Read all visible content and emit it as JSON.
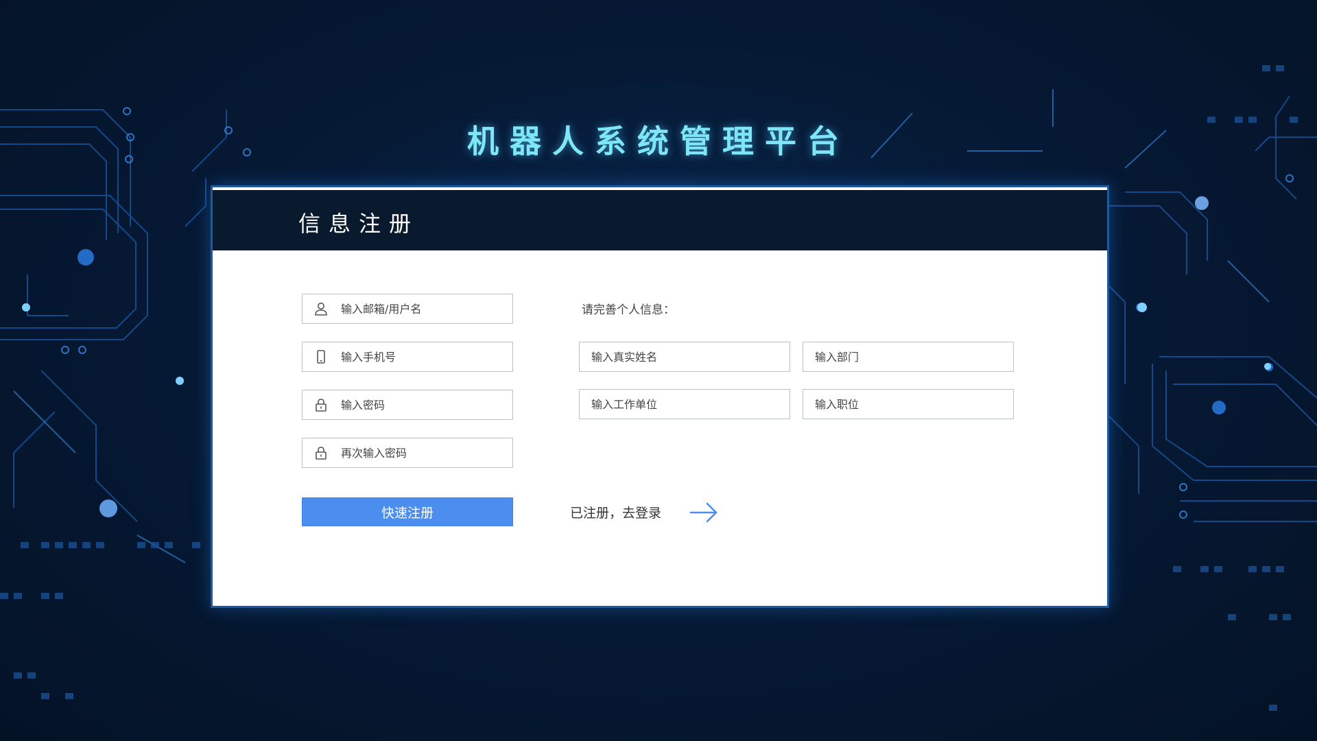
{
  "app": {
    "title": "机器人系统管理平台"
  },
  "register_card": {
    "heading": "信息注册",
    "account_fields": {
      "username": {
        "placeholder": "输入邮箱/用户名",
        "icon": "user-icon"
      },
      "phone": {
        "placeholder": "输入手机号",
        "icon": "phone-icon"
      },
      "password": {
        "placeholder": "输入密码",
        "icon": "lock-icon"
      },
      "password_confirm": {
        "placeholder": "再次输入密码",
        "icon": "lock-icon"
      }
    },
    "info_label": "请完善个人信息：",
    "profile_fields": {
      "real_name": {
        "placeholder": "输入真实姓名"
      },
      "department": {
        "placeholder": "输入部门"
      },
      "work_unit": {
        "placeholder": "输入工作单位"
      },
      "position": {
        "placeholder": "输入职位"
      }
    },
    "submit_label": "快速注册",
    "login_link_label": "已注册，去登录",
    "login_arrow_icon": "arrow-right-icon"
  },
  "colors": {
    "background": "#061a36",
    "title": "#7fe6f6",
    "card_header": "#0a1a2e",
    "card_border": "#1d5aa0",
    "primary_button": "#4b8ef0",
    "arrow": "#4b8ef0",
    "field_border": "#b9c0c8"
  }
}
